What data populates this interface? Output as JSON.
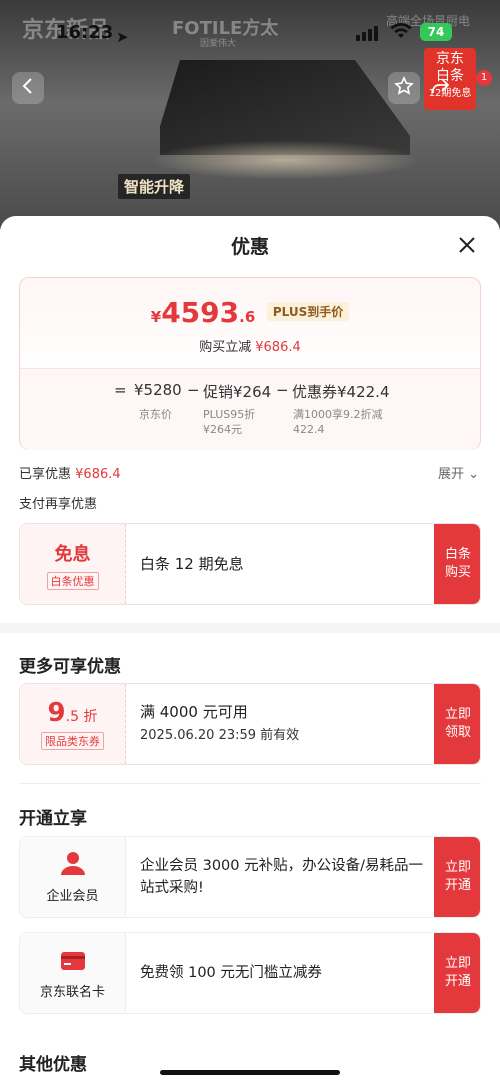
{
  "background": {
    "brand_left": "京东新品",
    "brand_right": "FOTILE方太",
    "brand_right_sub": "因爱伟大",
    "hero_tag": "智能升降",
    "corner_text": "高端全场景厨电"
  },
  "status_bar": {
    "time": "16:23",
    "battery": "74"
  },
  "top_bar": {
    "back_icon": "chevron-left-icon",
    "fav_icon": "star-icon",
    "share_icon": "share-icon",
    "more_icon": "more-dots-icon",
    "badge_count": "1",
    "jd_badge_line1": "京东",
    "jd_badge_line2": "白条",
    "jd_badge_line3": "12期免息"
  },
  "sheet": {
    "title": "优惠",
    "close_icon": "close-icon"
  },
  "price_card": {
    "yen": "¥",
    "price_int": "4593",
    "price_dec": ".6",
    "plus_label": "PLUS到手价",
    "instant_label": "购买立减",
    "instant_value": "¥686.4",
    "eq": "=",
    "jd_price": "¥5280",
    "minus1": "−",
    "promo": "促销¥264",
    "minus2": "−",
    "coupon": "优惠券¥422.4",
    "jd_price_note": "京东价",
    "promo_note_1": "PLUS95折",
    "promo_note_2": "¥264元",
    "coupon_note_1": "满1000享9.2折减",
    "coupon_note_2": "422.4"
  },
  "enjoyed": {
    "label": "已享优惠",
    "value": "¥686.4",
    "expand_label": "展开"
  },
  "pay_section": {
    "title": "支付再享优惠",
    "left_title": "免息",
    "left_tag": "白条优惠",
    "desc": "白条 12 期免息",
    "action_1": "白条",
    "action_2": "购买"
  },
  "more_section": {
    "title": "更多可享优惠",
    "discount_big": "9",
    "discount_small": ".5 折",
    "left_tag": "限品类东券",
    "line1": "满 4000 元可用",
    "line2": "2025.06.20 23:59 前有效",
    "action_1": "立即",
    "action_2": "领取"
  },
  "open_section": {
    "title": "开通立享",
    "items": [
      {
        "label": "企业会员",
        "icon": "user-icon",
        "desc": "企业会员 3000 元补贴，办公设备/易耗品一站式采购!",
        "action_1": "立即",
        "action_2": "开通"
      },
      {
        "label": "京东联名卡",
        "icon": "credit-card-icon",
        "desc": "免费领 100 元无门槛立减券",
        "action_1": "立即",
        "action_2": "开通"
      }
    ]
  },
  "other_section": {
    "title": "其他优惠"
  },
  "colors": {
    "accent_red": "#e4393c",
    "plus_gold": "#8c5b1f",
    "battery_green": "#34c759"
  }
}
